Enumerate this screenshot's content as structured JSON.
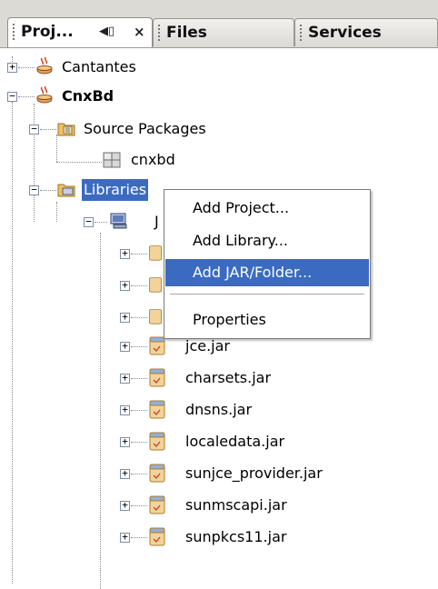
{
  "tabs": [
    {
      "label": "Proj...",
      "active": true,
      "controls": [
        "◀▯",
        "×"
      ]
    },
    {
      "label": "Files",
      "active": false
    },
    {
      "label": "Services",
      "active": false
    }
  ],
  "tree": {
    "cantantes": "Cantantes",
    "cnxbd": "CnxBd",
    "source_packages": "Source Packages",
    "package_cnxbd": "cnxbd",
    "libraries": "Libraries",
    "jdk_prefix": "J",
    "jars": [
      "jce.jar",
      "charsets.jar",
      "dnsns.jar",
      "localedata.jar",
      "sunjce_provider.jar",
      "sunmscapi.jar",
      "sunpkcs11.jar"
    ]
  },
  "context_menu": {
    "items": [
      "Add Project...",
      "Add Library...",
      "Add JAR/Folder...",
      "Properties"
    ],
    "highlighted": "Add JAR/Folder..."
  },
  "colors": {
    "selection": "#3b6bc1",
    "tab_bg": "#dcdad5"
  }
}
